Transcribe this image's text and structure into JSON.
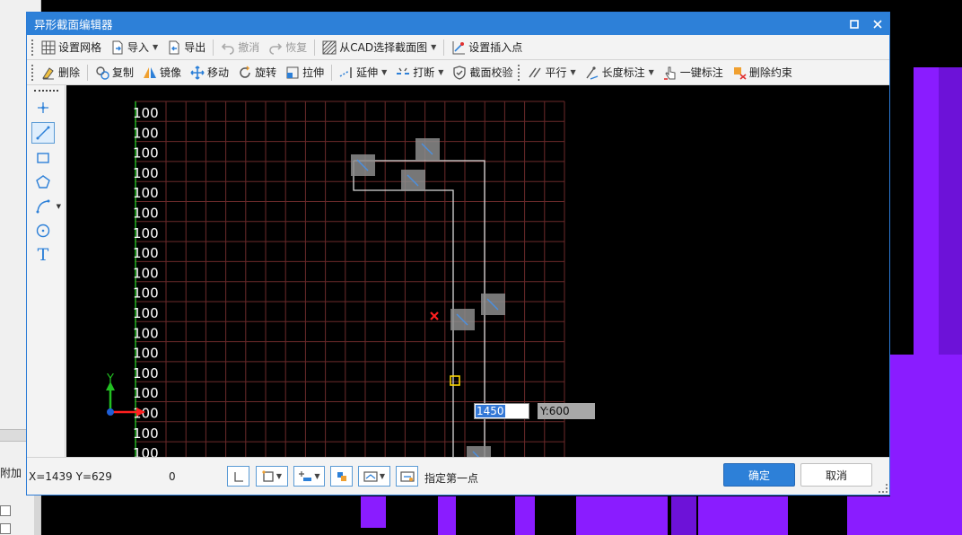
{
  "dialog": {
    "title": "异形截面编辑器",
    "maximize_glyph": "▫",
    "close_glyph": "✕"
  },
  "toolbar1": {
    "grid": "设置网格",
    "import": "导入",
    "export": "导出",
    "undo": "撤消",
    "redo": "恢复",
    "from_cad": "从CAD选择截面图",
    "insert_point": "设置插入点"
  },
  "toolbar2": {
    "delete": "删除",
    "copy": "复制",
    "mirror": "镜像",
    "move": "移动",
    "rotate": "旋转",
    "stretch": "拉伸",
    "extend": "延伸",
    "break": "打断",
    "check": "截面校验",
    "parallel": "平行",
    "length_dim": "长度标注",
    "one_key_dim": "一键标注",
    "delete_constraint": "删除约束"
  },
  "left_tools": {
    "text_glyph": "T"
  },
  "canvas": {
    "row_labels": [
      "100",
      "100",
      "100",
      "100",
      "100",
      "100",
      "100",
      "100",
      "100",
      "100",
      "100",
      "100",
      "100",
      "100",
      "100",
      "100",
      "100",
      "100"
    ],
    "axis_y_label": "Y",
    "coord_input_x": "1450",
    "coord_input_y": "Y:600",
    "colors": {
      "background": "#000000",
      "grid": "#6b2a2a",
      "profile": "#d9d9d9",
      "axis_y": "#22c022",
      "axis_x": "#ff2020",
      "snap": "#ffd700",
      "marker": "#ff2020"
    }
  },
  "status": {
    "position": "X=1439 Y=629",
    "count": "0",
    "hint": "指定第一点",
    "ok": "确定",
    "cancel": "取消"
  },
  "background_app": {
    "tab_label": "附加",
    "accent": "#8a1cff"
  }
}
